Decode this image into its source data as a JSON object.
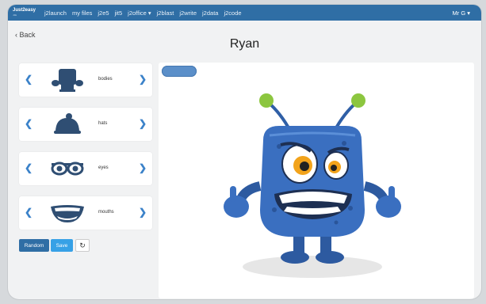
{
  "nav": {
    "logo": "Just2easy",
    "logo_sub": "J2E",
    "links": [
      "j2launch",
      "my files",
      "j2e5",
      "jit5",
      "j2office ▾",
      "j2blast",
      "j2write",
      "j2data",
      "j2code"
    ],
    "user": "Mr G ▾"
  },
  "back_label": "‹ Back",
  "title": "Ryan",
  "parts": [
    {
      "label": "bodies"
    },
    {
      "label": "hats"
    },
    {
      "label": "eyes"
    },
    {
      "label": "mouths"
    }
  ],
  "buttons": {
    "random": "Random",
    "save": "Save",
    "refresh": "↻"
  },
  "colors": {
    "nav": "#2f6ea5",
    "accent": "#3b82c9",
    "monster_body": "#3a6fc0"
  }
}
